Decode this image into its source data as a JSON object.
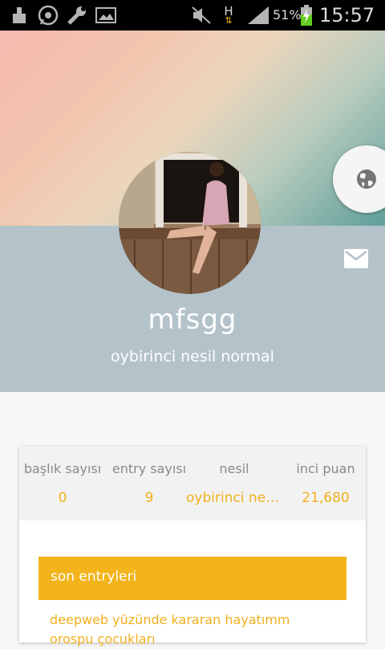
{
  "status_bar": {
    "battery_percent": "51%",
    "time": "15:57",
    "network_label": "H"
  },
  "profile": {
    "username": "mfsgg",
    "subtitle": "oybirinci nesil normal"
  },
  "stats": [
    {
      "label": "başlık sayısı",
      "value": "0"
    },
    {
      "label": "entry sayısı",
      "value": "9"
    },
    {
      "label": "nesil",
      "value": "oybirinci nesil normal"
    },
    {
      "label": "inci puan",
      "value": "21,680"
    }
  ],
  "entries": {
    "header": "son entryleri",
    "items": [
      {
        "title": "deepweb yüzünde kararan hayatımm orospu çocukları"
      }
    ]
  },
  "colors": {
    "accent": "#f3b31a",
    "band": "#b4c2ca"
  }
}
